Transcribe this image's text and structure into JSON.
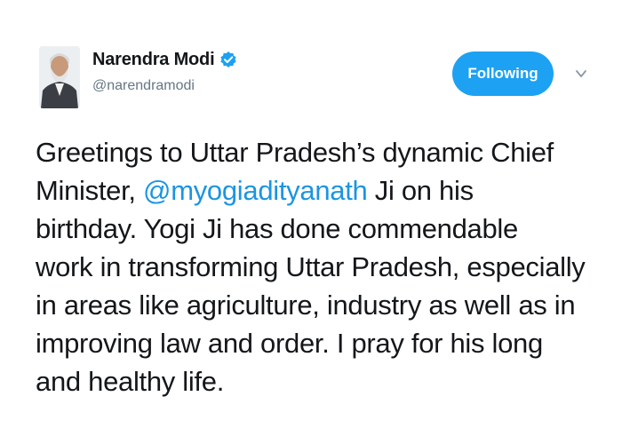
{
  "author": {
    "display_name": "Narendra Modi",
    "handle": "@narendramodi",
    "verified": true
  },
  "follow_button": {
    "label": "Following"
  },
  "menu": {
    "icon": "chevron-down-icon"
  },
  "tweet": {
    "lines": [
      {
        "text": "Greetings to Uttar Pradesh’s dynamic Chief"
      },
      {
        "prefix": "Minister, ",
        "mention": "@myogiadityanath",
        "suffix": " Ji on his"
      },
      {
        "text": "birthday. Yogi Ji has done commendable"
      },
      {
        "text": "work in transforming Uttar Pradesh, especially"
      },
      {
        "text": "in areas like agriculture, industry as well as in"
      },
      {
        "text": "improving law and order. I pray for his long"
      },
      {
        "text": "and healthy life."
      }
    ]
  },
  "colors": {
    "accent": "#1da1f2",
    "mention": "#1b95e0",
    "text": "#14171a",
    "muted": "#657786"
  }
}
